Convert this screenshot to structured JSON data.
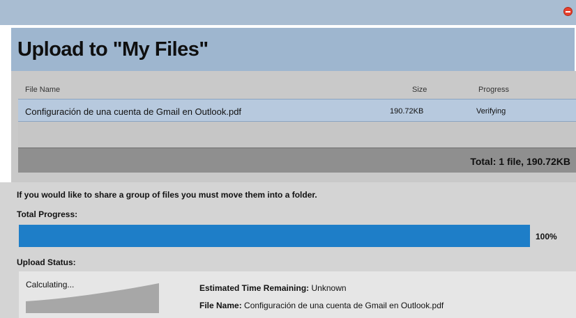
{
  "dialog": {
    "title": "Upload to \"My Files\"",
    "close_icon": "close-icon"
  },
  "table": {
    "columns": [
      "File Name",
      "Size",
      "Progress"
    ],
    "rows": [
      {
        "name": "Configuración de una cuenta de Gmail en Outlook.pdf",
        "size": "190.72KB",
        "progress": "Verifying"
      }
    ],
    "total": "Total: 1 file, 190.72KB"
  },
  "info_message": "If you would like to share a group of files you must move them into a folder.",
  "total_progress": {
    "label": "Total Progress:",
    "percent_text": "100%",
    "value": 1.0,
    "bar_color": "#1e7ec8"
  },
  "upload_status": {
    "label": "Upload Status:",
    "state": "Calculating...",
    "time_label": "Estimated Time Remaining:",
    "time_value": "Unknown",
    "file_label": "File Name:",
    "file_value": "Configuración de una cuenta de Gmail en Outlook.pdf"
  }
}
